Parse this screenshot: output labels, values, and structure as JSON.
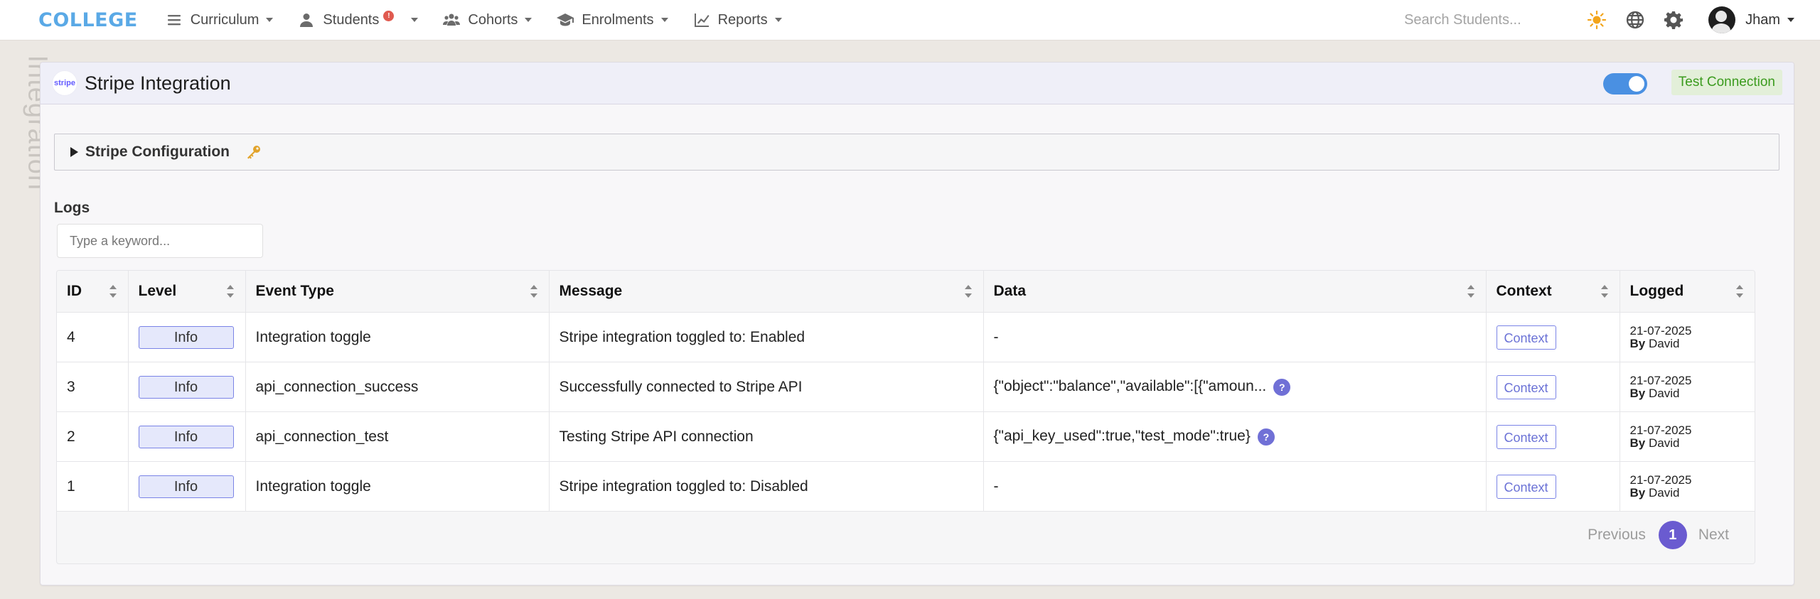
{
  "brand": "COLLEGE",
  "nav": {
    "items": [
      {
        "label": "Curriculum",
        "icon": "list-icon"
      },
      {
        "label": "Students",
        "icon": "user-icon",
        "badge": "!"
      },
      {
        "label": "Cohorts",
        "icon": "users-icon"
      },
      {
        "label": "Enrolments",
        "icon": "graduation-cap-icon"
      },
      {
        "label": "Reports",
        "icon": "line-chart-icon"
      }
    ],
    "search_placeholder": "Search Students...",
    "user_name": "Jham"
  },
  "side_label": "Integration",
  "card": {
    "logo_text": "stripe",
    "title": "Stripe Integration",
    "toggle_on": true,
    "test_button": "Test Connection"
  },
  "config": {
    "label": "Stripe Configuration"
  },
  "logs": {
    "label": "Logs",
    "search_placeholder": "Type a keyword...",
    "columns": [
      "ID",
      "Level",
      "Event Type",
      "Message",
      "Data",
      "Context",
      "Logged"
    ],
    "rows": [
      {
        "id": "4",
        "level": "Info",
        "event": "Integration toggle",
        "message": "Stripe integration toggled to: Enabled",
        "data": "-",
        "data_more": false,
        "context": "Context",
        "date": "21-07-2025",
        "by": "By",
        "user": "David"
      },
      {
        "id": "3",
        "level": "Info",
        "event": "api_connection_success",
        "message": "Successfully connected to Stripe API",
        "data": "{\"object\":\"balance\",\"available\":[{\"amoun...",
        "data_more": true,
        "context": "Context",
        "date": "21-07-2025",
        "by": "By",
        "user": "David"
      },
      {
        "id": "2",
        "level": "Info",
        "event": "api_connection_test",
        "message": "Testing Stripe API connection",
        "data": "{\"api_key_used\":true,\"test_mode\":true}",
        "data_more": true,
        "context": "Context",
        "date": "21-07-2025",
        "by": "By",
        "user": "David"
      },
      {
        "id": "1",
        "level": "Info",
        "event": "Integration toggle",
        "message": "Stripe integration toggled to: Disabled",
        "data": "-",
        "data_more": false,
        "context": "Context",
        "date": "21-07-2025",
        "by": "By",
        "user": "David"
      }
    ]
  },
  "pagination": {
    "previous": "Previous",
    "current": "1",
    "next": "Next"
  },
  "colors": {
    "brand": "#5aa9e6",
    "accent": "#6a5bd0",
    "toggle": "#4a90e2",
    "success": "#3b9b1e"
  }
}
